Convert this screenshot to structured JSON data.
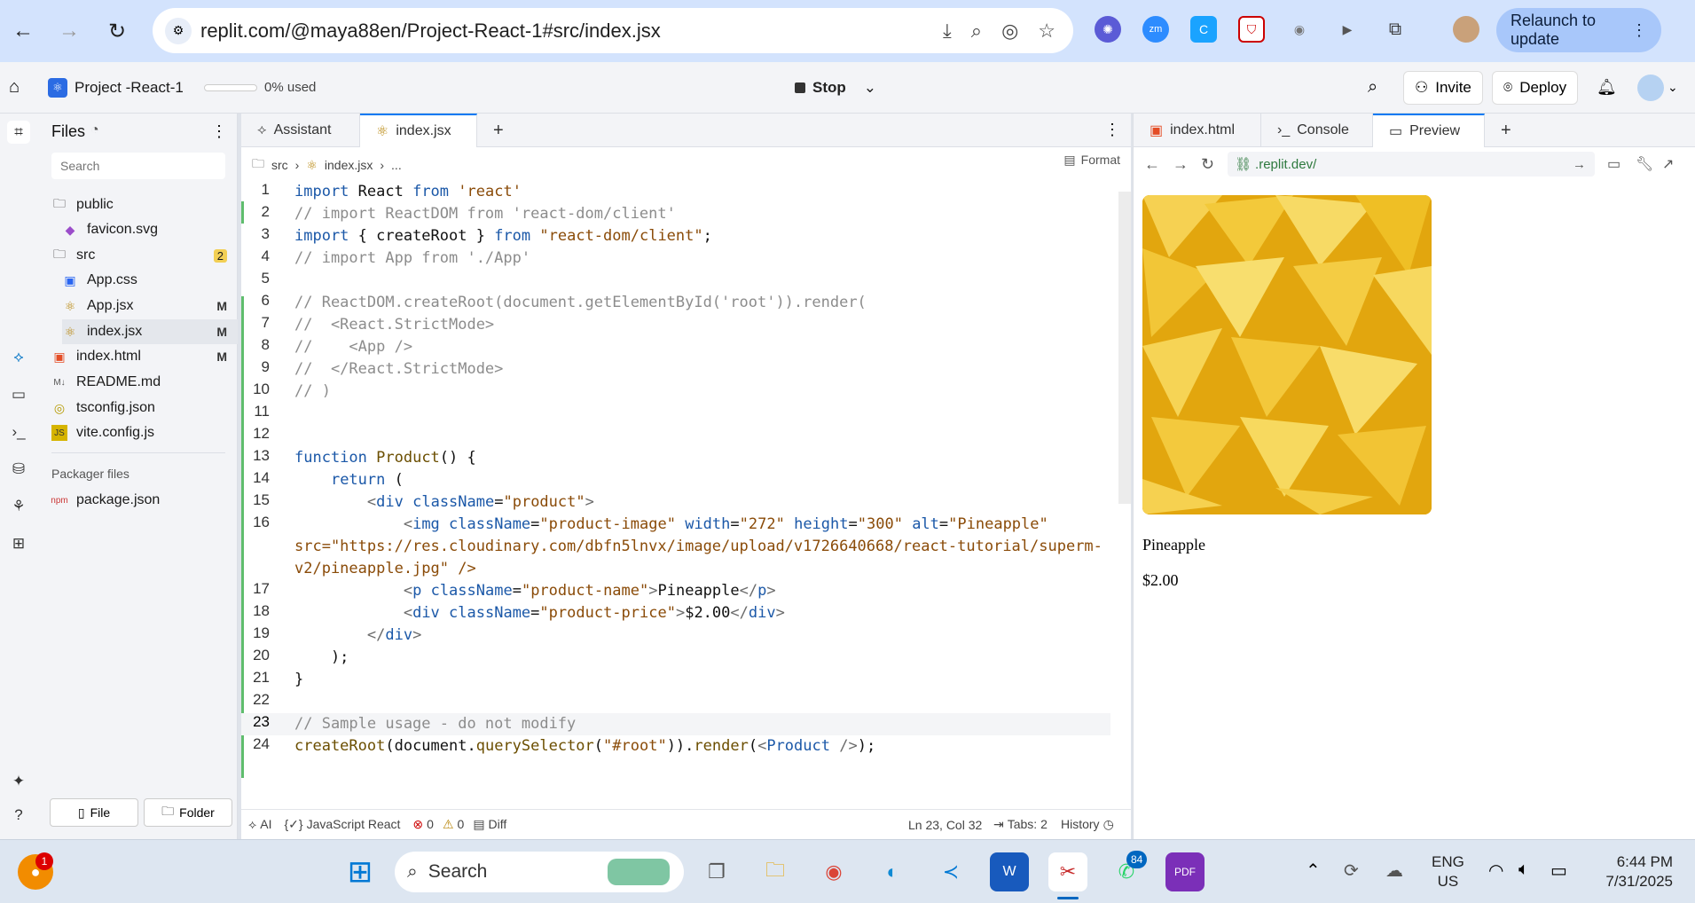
{
  "browser": {
    "url": "replit.com/@maya88en/Project-React-1#src/index.jsx",
    "relaunch_label": "Relaunch to update"
  },
  "appbar": {
    "project_name": "Project -React-1",
    "usage": "0% used",
    "stop_label": "Stop",
    "invite_label": "Invite",
    "deploy_label": "Deploy"
  },
  "files": {
    "title": "Files",
    "search_placeholder": "Search",
    "items": [
      {
        "label": "public",
        "type": "folder"
      },
      {
        "label": "favicon.svg",
        "type": "svg"
      },
      {
        "label": "src",
        "type": "folder",
        "badge": "2"
      },
      {
        "label": "App.css",
        "type": "css"
      },
      {
        "label": "App.jsx",
        "type": "jsx",
        "status": "M"
      },
      {
        "label": "index.jsx",
        "type": "jsx",
        "status": "M"
      },
      {
        "label": "index.html",
        "type": "html",
        "status": "M"
      },
      {
        "label": "README.md",
        "type": "md"
      },
      {
        "label": "tsconfig.json",
        "type": "json"
      },
      {
        "label": "vite.config.js",
        "type": "js"
      }
    ],
    "packager_heading": "Packager files",
    "packager_items": [
      {
        "label": "package.json"
      }
    ],
    "new_file_label": "File",
    "new_folder_label": "Folder"
  },
  "editor": {
    "tabs": [
      {
        "label": "Assistant"
      },
      {
        "label": "index.jsx"
      }
    ],
    "breadcrumb": [
      "src",
      "index.jsx",
      "..."
    ],
    "format_label": "Format",
    "lines": [
      "import React from 'react'",
      "// import ReactDOM from 'react-dom/client'",
      "import { createRoot } from \"react-dom/client\";",
      "// import App from './App'",
      "",
      "// ReactDOM.createRoot(document.getElementById('root')).render(",
      "//  <React.StrictMode>",
      "//    <App />",
      "//  </React.StrictMode>",
      "// )",
      "",
      "",
      "function Product() {",
      "    return (",
      "        <div className=\"product\">",
      "            <img className=\"product-image\" width=\"272\" height=\"300\" alt=\"Pineapple\"",
      "            <p className=\"product-name\">Pineapple</p>",
      "            <div className=\"product-price\">$2.00</div>",
      "        </div>",
      "    );",
      "}",
      "",
      "// Sample usage - do not modify",
      "createRoot(document.querySelector(\"#root\")).render(<Product />);"
    ],
    "line16_wrap1": "src=\"https://res.cloudinary.com/dbfn5lnvx/image/upload/v1726640668/react-tutorial/superm-",
    "line16_wrap2": "v2/pineapple.jpg\" />",
    "status": {
      "ai": "AI",
      "language": "JavaScript React",
      "errors": "0",
      "warnings": "0",
      "diff": "Diff",
      "cursor": "Ln 23, Col 32",
      "tabs": "Tabs: 2",
      "history": "History"
    }
  },
  "preview_panel": {
    "tabs": [
      {
        "label": "index.html"
      },
      {
        "label": "Console"
      },
      {
        "label": "Preview"
      }
    ],
    "url": ".replit.dev/",
    "product_name": "Pineapple",
    "product_price": "$2.00"
  },
  "taskbar": {
    "search_label": "Search",
    "notif_count": "1",
    "whatsapp_count": "84",
    "lang1": "ENG",
    "lang2": "US",
    "time": "6:44 PM",
    "date": "7/31/2025"
  }
}
